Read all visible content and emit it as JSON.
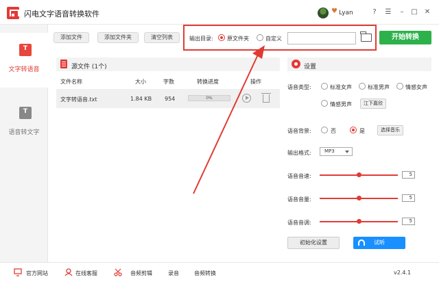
{
  "app": {
    "title": "闪电文字语音转换软件",
    "username": "Lyan"
  },
  "window_controls": {
    "help": "?",
    "menu": "☰",
    "minimize": "–",
    "maximize": "□",
    "close": "✕"
  },
  "sidebar": {
    "items": [
      {
        "label": "文字转语音",
        "icon_text": "T",
        "active": true
      },
      {
        "label": "语音转文字",
        "icon_text": "T",
        "active": false
      }
    ]
  },
  "toolbar": {
    "add_file": "添加文件",
    "add_folder": "添加文件夹",
    "clear_list": "清空列表",
    "output_dir_label": "输出目录:",
    "option_source_folder": "原文件夹",
    "option_custom": "自定义",
    "path_value": "",
    "start": "开始转换"
  },
  "source_panel": {
    "title": "源文件 (1个)",
    "columns": [
      "文件名称",
      "大小",
      "字数",
      "转换进度",
      "操作"
    ],
    "rows": [
      {
        "name": "文字转语音.txt",
        "size": "1.84 KB",
        "chars": "954",
        "progress": "0%",
        "progress_value": 0
      }
    ]
  },
  "settings": {
    "title": "设置",
    "voice_type_label": "语音类型:",
    "voice_types": [
      "标准女声",
      "标准男声",
      "情感女声",
      "情感男声"
    ],
    "voice_extra": "江下嘉欣",
    "bg_label": "语音背景:",
    "bg_no": "否",
    "bg_yes": "是",
    "bg_selected": "是",
    "choose_music": "选择音乐",
    "format_label": "输出格式:",
    "format_value": "MP3",
    "speed_label": "语音音速:",
    "speed_value": "5",
    "volume_label": "语音音量:",
    "volume_value": "5",
    "pitch_label": "语音音调:",
    "pitch_value": "5",
    "init_btn": "初始化设置",
    "listen_btn": "试听"
  },
  "bottom": {
    "website": "官方网站",
    "service": "在线客服",
    "audio_cut": "音频剪辑",
    "record": "录音",
    "audio_convert": "音频转换",
    "version": "v2.4.1"
  },
  "colors": {
    "accent": "#e23a36",
    "start": "#2db24b",
    "listen": "#1890ff",
    "highlight_box": "#e03b33"
  }
}
